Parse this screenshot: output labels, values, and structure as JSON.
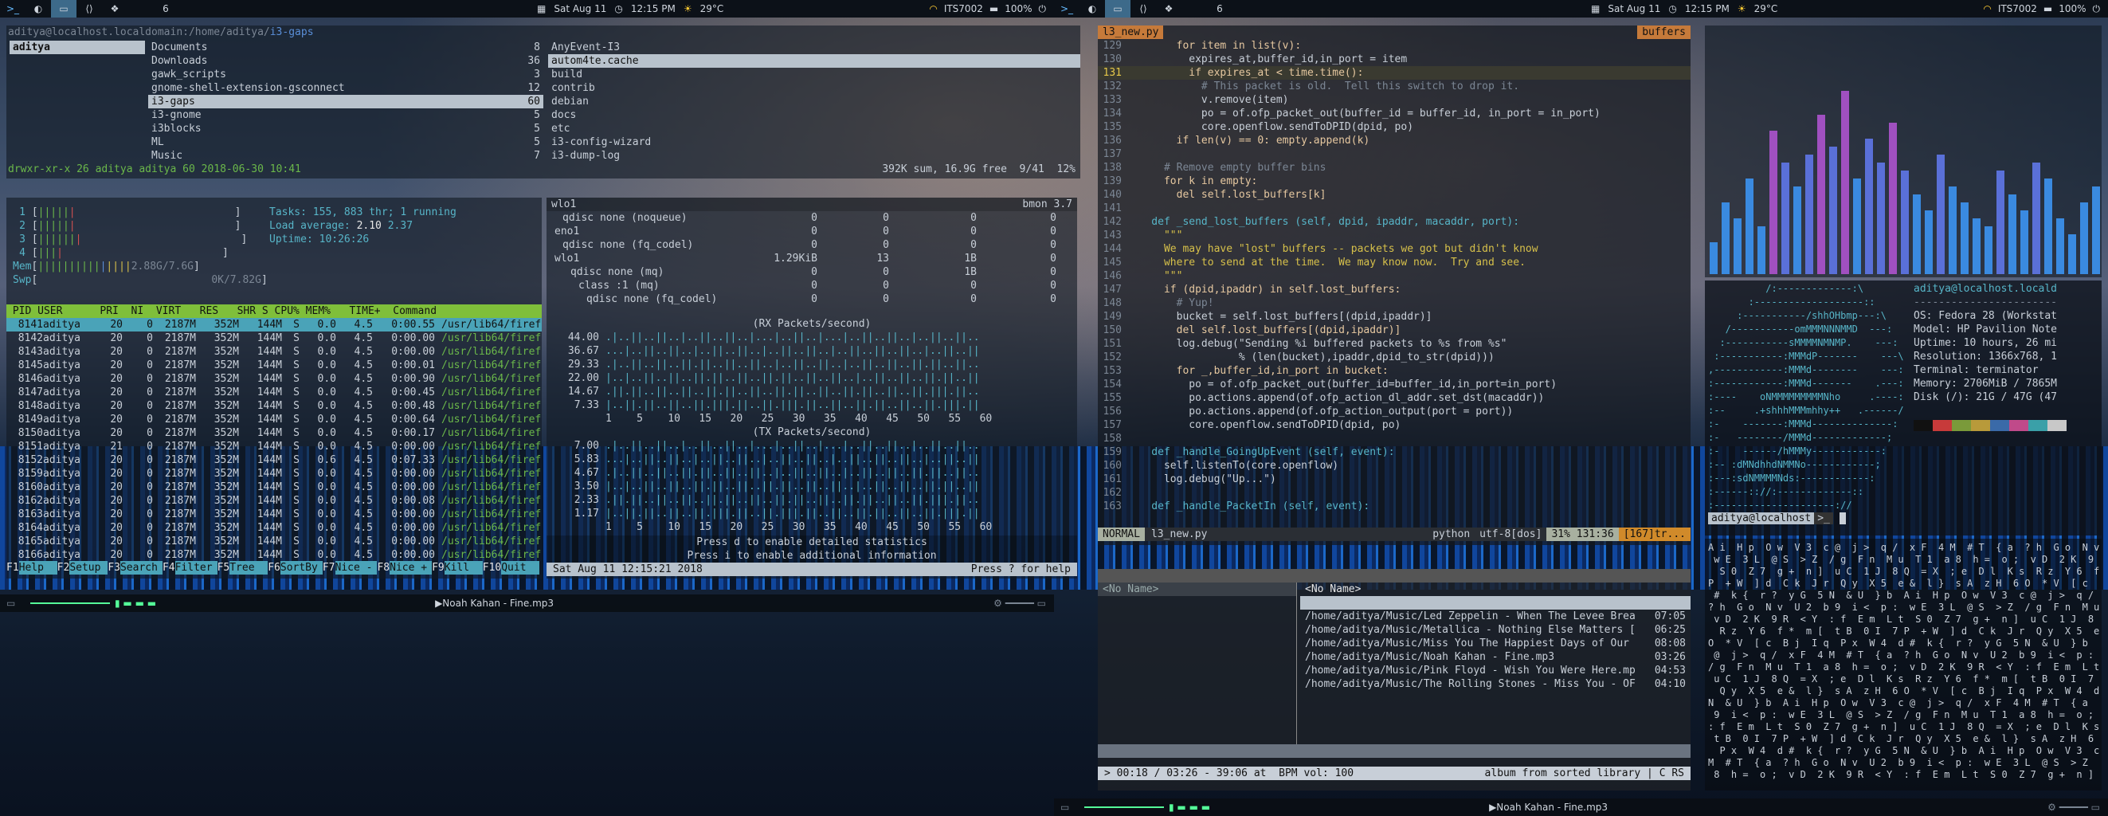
{
  "statusbar": {
    "left_ws": [
      "1",
      "2",
      "3",
      "4",
      "5",
      "6"
    ],
    "right_ws": [
      "1",
      "2",
      "3",
      "4",
      "5",
      "6"
    ],
    "date": "Sat Aug 11",
    "time": "12:15 PM",
    "temp": "29°C",
    "wifi": "ITS7002",
    "battery": "100%"
  },
  "ranger": {
    "path_user": "aditya@localhost.localdomain",
    "path_dir": ":/home/aditya/",
    "path_cur": "i3-gaps",
    "col1": [
      "aditya"
    ],
    "col2": [
      [
        "Documents",
        "8"
      ],
      [
        "Downloads",
        "36"
      ],
      [
        "gawk_scripts",
        "3"
      ],
      [
        "gnome-shell-extension-gsconnect",
        "12"
      ],
      [
        "i3-gaps",
        "60"
      ],
      [
        "i3-gnome",
        "5"
      ],
      [
        "i3blocks",
        "5"
      ],
      [
        "ML",
        "5"
      ],
      [
        "Music",
        "7"
      ]
    ],
    "col3": [
      "AnyEvent-I3",
      "autom4te.cache",
      "build",
      "contrib",
      "debian",
      "docs",
      "etc",
      "i3-config-wizard",
      "i3-dump-log"
    ],
    "status_left": "drwxr-xr-x 26 aditya aditya 60 2018-06-30 10:41",
    "status_right": "392K sum, 16.9G free  9/41  12%"
  },
  "htop": {
    "cpus": [
      "1",
      "2",
      "3",
      "4"
    ],
    "tasks": "Tasks: 155, 883 thr; 1 running",
    "load": "Load average:",
    "load1": "2.10",
    "load2": "2.37",
    "uptime": "Uptime: 10:26:26",
    "mem": "Mem",
    "memv": "2.88G/7.6G",
    "swp": "Swp",
    "swpv": "0K/7.82G",
    "header": " PID USER      PRI  NI  VIRT   RES   SHR S CPU% MEM%   TIME+  Command",
    "rows": [
      [
        "8141",
        "aditya",
        "20",
        "0",
        "2187M",
        "352M",
        "144M",
        "S",
        "0.0",
        "4.5",
        "0:00.55"
      ],
      [
        "8142",
        "aditya",
        "20",
        "0",
        "2187M",
        "352M",
        "144M",
        "S",
        "0.0",
        "4.5",
        "0:00.00"
      ],
      [
        "8143",
        "aditya",
        "20",
        "0",
        "2187M",
        "352M",
        "144M",
        "S",
        "0.0",
        "4.5",
        "0:00.00"
      ],
      [
        "8145",
        "aditya",
        "20",
        "0",
        "2187M",
        "352M",
        "144M",
        "S",
        "0.0",
        "4.5",
        "0:00.01"
      ],
      [
        "8146",
        "aditya",
        "20",
        "0",
        "2187M",
        "352M",
        "144M",
        "S",
        "0.0",
        "4.5",
        "0:00.90"
      ],
      [
        "8147",
        "aditya",
        "20",
        "0",
        "2187M",
        "352M",
        "144M",
        "S",
        "0.0",
        "4.5",
        "0:00.45"
      ],
      [
        "8148",
        "aditya",
        "20",
        "0",
        "2187M",
        "352M",
        "144M",
        "S",
        "0.0",
        "4.5",
        "0:00.48"
      ],
      [
        "8149",
        "aditya",
        "20",
        "0",
        "2187M",
        "352M",
        "144M",
        "S",
        "0.0",
        "4.5",
        "0:00.64"
      ],
      [
        "8150",
        "aditya",
        "20",
        "0",
        "2187M",
        "352M",
        "144M",
        "S",
        "0.0",
        "4.5",
        "0:00.17"
      ],
      [
        "8151",
        "aditya",
        "21",
        "0",
        "2187M",
        "352M",
        "144M",
        "S",
        "0.0",
        "4.5",
        "0:00.00"
      ],
      [
        "8152",
        "aditya",
        "20",
        "0",
        "2187M",
        "352M",
        "144M",
        "S",
        "0.6",
        "4.5",
        "0:07.33"
      ],
      [
        "8159",
        "aditya",
        "20",
        "0",
        "2187M",
        "352M",
        "144M",
        "S",
        "0.0",
        "4.5",
        "0:00.00"
      ],
      [
        "8160",
        "aditya",
        "20",
        "0",
        "2187M",
        "352M",
        "144M",
        "S",
        "0.0",
        "4.5",
        "0:00.00"
      ],
      [
        "8162",
        "aditya",
        "20",
        "0",
        "2187M",
        "352M",
        "144M",
        "S",
        "0.0",
        "4.5",
        "0:00.08"
      ],
      [
        "8163",
        "aditya",
        "20",
        "0",
        "2187M",
        "352M",
        "144M",
        "S",
        "0.0",
        "4.5",
        "0:00.00"
      ],
      [
        "8164",
        "aditya",
        "20",
        "0",
        "2187M",
        "352M",
        "144M",
        "S",
        "0.0",
        "4.5",
        "0:00.00"
      ],
      [
        "8165",
        "aditya",
        "20",
        "0",
        "2187M",
        "352M",
        "144M",
        "S",
        "0.0",
        "4.5",
        "0:00.00"
      ],
      [
        "8166",
        "aditya",
        "20",
        "0",
        "2187M",
        "352M",
        "144M",
        "S",
        "0.0",
        "4.5",
        "0:00.00"
      ]
    ],
    "cmd": "/usr/lib64/firefox/f",
    "fkeys": [
      [
        "F1",
        "Help"
      ],
      [
        "F2",
        "Setup"
      ],
      [
        "F3",
        "Search"
      ],
      [
        "F4",
        "Filter"
      ],
      [
        "F5",
        "Tree"
      ],
      [
        "F6",
        "SortBy"
      ],
      [
        "F7",
        "Nice -"
      ],
      [
        "F8",
        "Nice +"
      ],
      [
        "F9",
        "Kill"
      ],
      [
        "F10",
        "Quit"
      ]
    ]
  },
  "bmon": {
    "iface": "wlo1",
    "title": "bmon 3.7",
    "rows": [
      [
        "qdisc none (noqueue)",
        "0",
        "0",
        "0",
        "0"
      ],
      [
        "eno1",
        "0",
        "0",
        "0",
        "0"
      ],
      [
        "qdisc none (fq_codel)",
        "0",
        "0",
        "0",
        "0"
      ],
      [
        "wlo1",
        "1.29KiB",
        "13",
        "1B",
        "0"
      ],
      [
        "qdisc none (mq)",
        "0",
        "0",
        "1B",
        "0"
      ],
      [
        "class :1 (mq)",
        "0",
        "0",
        "0",
        "0"
      ],
      [
        "qdisc none (fq_codel)",
        "0",
        "0",
        "0",
        "0"
      ]
    ],
    "rx_title": "(RX Packets/second)",
    "rx_y": [
      "44.00",
      "36.67",
      "29.33",
      "22.00",
      "14.67",
      "7.33"
    ],
    "tx_title": "(TX Packets/second)",
    "tx_y": [
      "7.00",
      "5.83",
      "4.67",
      "3.50",
      "2.33",
      "1.17"
    ],
    "x": "1    5    10   15   20   25   30   35   40   45   50   55   60",
    "hint1": "Press d to enable detailed statistics",
    "hint2": "Press i to enable additional information",
    "date": "Sat Aug 11 12:15:21 2018",
    "help": "Press ? for help"
  },
  "vim": {
    "tab": "l3_new.py",
    "buffers": "buffers",
    "start": 129,
    "lines": [
      "        for item in list(v):",
      "          expires_at,buffer_id,in_port = item",
      "          if expires_at < time.time():",
      "            # This packet is old.  Tell this switch to drop it.",
      "            v.remove(item)",
      "            po = of.ofp_packet_out(buffer_id = buffer_id, in_port = in_port)",
      "            core.openflow.sendToDPID(dpid, po)",
      "        if len(v) == 0: empty.append(k)",
      "",
      "      # Remove empty buffer bins",
      "      for k in empty:",
      "        del self.lost_buffers[k]",
      "",
      "    def _send_lost_buffers (self, dpid, ipaddr, macaddr, port):",
      "      \"\"\"",
      "      We may have \"lost\" buffers -- packets we got but didn't know",
      "      where to send at the time.  We may know now.  Try and see.",
      "      \"\"\"",
      "      if (dpid,ipaddr) in self.lost_buffers:",
      "        # Yup!",
      "        bucket = self.lost_buffers[(dpid,ipaddr)]",
      "        del self.lost_buffers[(dpid,ipaddr)]",
      "        log.debug(\"Sending %i buffered packets to %s from %s\"",
      "                  % (len(bucket),ipaddr,dpid_to_str(dpid)))",
      "        for _,buffer_id,in_port in bucket:",
      "          po = of.ofp_packet_out(buffer_id=buffer_id,in_port=in_port)",
      "          po.actions.append(of.ofp_action_dl_addr.set_dst(macaddr))",
      "          po.actions.append(of.ofp_action_output(port = port))",
      "          core.openflow.sendToDPID(dpid, po)",
      "",
      "    def _handle_GoingUpEvent (self, event):",
      "      self.listenTo(core.openflow)",
      "      log.debug(\"Up...\")",
      "",
      "    def _handle_PacketIn (self, event):"
    ],
    "mode": "NORMAL",
    "file": "l3_new.py",
    "ft": "python",
    "enc": "utf-8[dos]",
    "pos": "31% 131:36",
    "warn": "[167]tr..."
  },
  "cmus": {
    "left": "<No Name>",
    "right_title": "<No Name>",
    "tracks": [
      [
        "/home/aditya/Music/Led Zeppelin - When The Levee Brea",
        "07:05"
      ],
      [
        "/home/aditya/Music/Metallica - Nothing Else Matters [",
        "06:25"
      ],
      [
        "/home/aditya/Music/Miss You The Happiest Days of Our",
        "08:08"
      ],
      [
        "/home/aditya/Music/Noah Kahan - Fine.mp3",
        "03:26"
      ],
      [
        "/home/aditya/Music/Pink Floyd - Wish You Were Here.mp",
        "04:53"
      ],
      [
        "/home/aditya/Music/The Rolling Stones - Miss You - OF",
        "04:10"
      ]
    ],
    "status_left": "> 00:18 / 03:26 - 39:06 at  BPM vol: 100",
    "status_right": "album from sorted library | C RS"
  },
  "neofetch": {
    "user": "aditya@localhost.locald",
    "os": "OS: Fedora 28 (Workstat",
    "model": "Model: HP Pavilion Note",
    "uptime": "Uptime: 10 hours, 26 mi",
    "res": "Resolution: 1366x768, 1",
    "term": "Terminal: terminator",
    "mem": "Memory: 2706MiB / 7865M",
    "disk": "Disk (/): 21G / 47G (47",
    "prompt": "aditya@localhost",
    "colors": [
      "#111111",
      "#c73a3a",
      "#7a9a3a",
      "#b89a3a",
      "#3a6aa8",
      "#c04a8a",
      "#3aa0a8",
      "#c8c8c8"
    ]
  },
  "bottom": {
    "track": "Noah Kahan - Fine.mp3"
  },
  "colors": {
    "accent": "#3d6a8a",
    "vim_mode": "#a8b0a0"
  }
}
